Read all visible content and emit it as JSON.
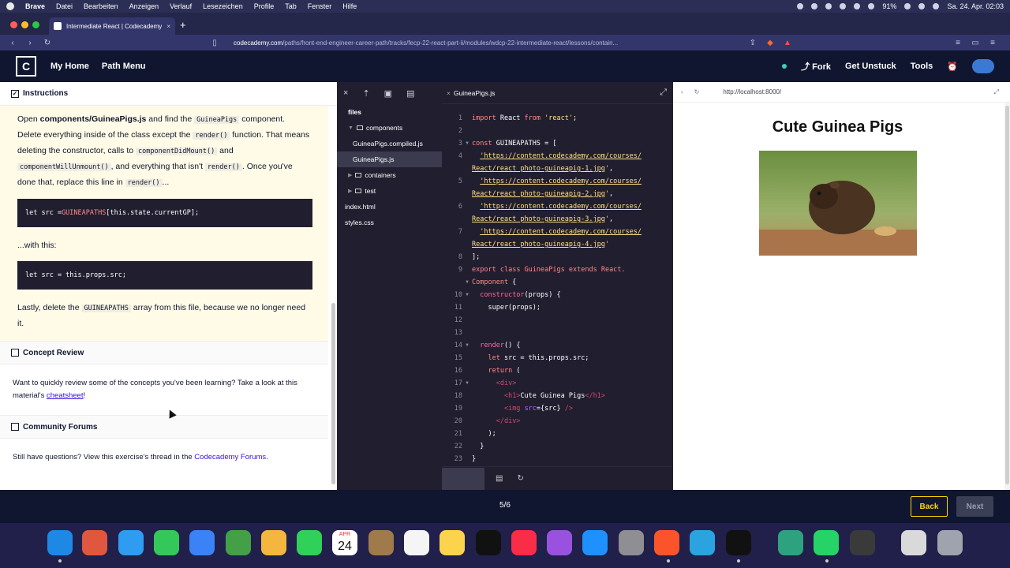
{
  "menubar": {
    "app": "Brave",
    "items": [
      "Datei",
      "Bearbeiten",
      "Anzeigen",
      "Verlauf",
      "Lesezeichen",
      "Profile",
      "Tab",
      "Fenster",
      "Hilfe"
    ],
    "battery": "91%",
    "clock": "Sa. 24. Apr. 02:03"
  },
  "browser": {
    "tab_title": "Intermediate React | Codecademy",
    "new_tab": "+",
    "url_domain": "codecademy.com",
    "url_path": "/paths/front-end-engineer-career-path/tracks/fecp-22-react-part-ii/modules/wdcp-22-intermediate-react/lessons/contain..."
  },
  "header": {
    "logo": "C",
    "nav": [
      "My Home",
      "Path Menu"
    ],
    "right": [
      "Fork",
      "Get Unstuck",
      "Tools"
    ]
  },
  "instructions": {
    "heading": "Instructions",
    "p1_a": "Open ",
    "p1_file": "components/GuineaPigs.js",
    "p1_b": " and find the ",
    "p1_comp": "GuineaPigs",
    "p1_c": " component. Delete everything inside of the class except the ",
    "p1_render": "render()",
    "p1_d": " function. That means deleting the constructor, calls to ",
    "p1_cdm": "componentDidMount()",
    "p1_e": " and ",
    "p1_cwu": "componentWillUnmount()",
    "p1_f": ", and everything that isn't ",
    "p1_render2": "render()",
    "p1_g": ". Once you've done that, replace this line in ",
    "p1_render3": "render()",
    "p1_h": "...",
    "code1_a": "let src = ",
    "code1_b": "GUINEAPATHS",
    "code1_c": "[this.state.currentGP];",
    "with_this": "...with this:",
    "code2": "let src = this.props.src;",
    "p2_a": "Lastly, delete the ",
    "p2_code": "GUINEAPATHS",
    "p2_b": " array from this file, because we no longer need it."
  },
  "concept_review": {
    "heading": "Concept Review",
    "text_a": "Want to quickly review some of the concepts you've been learning? Take a look at this material's ",
    "link": "cheatsheet",
    "text_b": "!"
  },
  "community": {
    "heading": "Community Forums",
    "text_a": "Still have questions? View this exercise's thread in the ",
    "link": "Codecademy Forums",
    "text_b": "."
  },
  "file_tree": {
    "root": "files",
    "items": [
      {
        "label": "components",
        "type": "folder",
        "open": true,
        "depth": 1
      },
      {
        "label": "GuineaPigs.compiled.js",
        "type": "file",
        "depth": 2
      },
      {
        "label": "GuineaPigs.js",
        "type": "file",
        "depth": 2,
        "selected": true
      },
      {
        "label": "containers",
        "type": "folder",
        "open": false,
        "depth": 1
      },
      {
        "label": "test",
        "type": "folder",
        "open": false,
        "depth": 1
      },
      {
        "label": "index.html",
        "type": "file",
        "depth": 0
      },
      {
        "label": "styles.css",
        "type": "file",
        "depth": 0
      }
    ]
  },
  "editor": {
    "tab": "GuineaPigs.js",
    "lines": [
      {
        "n": "1",
        "fold": "",
        "html": "<span class='kw'>import</span> React <span class='kw'>from</span> <span class='q'>'react'</span>;"
      },
      {
        "n": "2",
        "fold": "",
        "html": ""
      },
      {
        "n": "3",
        "fold": "▼",
        "html": "<span class='kw'>const</span> GUINEAPATHS = ["
      },
      {
        "n": "4",
        "fold": "",
        "html": "  <span class='str'>'https://content.codecademy.com/courses/</span>"
      },
      {
        "n": "",
        "fold": "",
        "html": "<span class='str'>React/react_photo-guineapig-1.jpg</span><span class='q'>'</span>,"
      },
      {
        "n": "5",
        "fold": "",
        "html": "  <span class='str'>'https://content.codecademy.com/courses/</span>"
      },
      {
        "n": "",
        "fold": "",
        "html": "<span class='str'>React/react_photo-guineapig-2.jpg</span><span class='q'>'</span>,"
      },
      {
        "n": "6",
        "fold": "",
        "html": "  <span class='str'>'https://content.codecademy.com/courses/</span>"
      },
      {
        "n": "",
        "fold": "",
        "html": "<span class='str'>React/react_photo-guineapig-3.jpg</span><span class='q'>'</span>,"
      },
      {
        "n": "7",
        "fold": "",
        "html": "  <span class='str'>'https://content.codecademy.com/courses/</span>"
      },
      {
        "n": "",
        "fold": "",
        "html": "<span class='str'>React/react_photo-guineapig-4.jpg</span><span class='q'>'</span>"
      },
      {
        "n": "8",
        "fold": "",
        "html": "];"
      },
      {
        "n": "9",
        "fold": "",
        "html": "<span class='kw'>export</span> <span class='kw'>class</span> <span class='cls'>GuineaPigs</span> <span class='kw'>extends</span> <span class='cls'>React.</span>"
      },
      {
        "n": "",
        "fold": "▼",
        "html": "<span class='cls'>Component</span> {"
      },
      {
        "n": "10",
        "fold": "▼",
        "html": "  <span class='fn'>constructor</span>(props) {"
      },
      {
        "n": "11",
        "fold": "",
        "html": "    super(props);"
      },
      {
        "n": "12",
        "fold": "",
        "html": ""
      },
      {
        "n": "13",
        "fold": "",
        "html": ""
      },
      {
        "n": "14",
        "fold": "▼",
        "html": "  <span class='fn'>render</span>() {"
      },
      {
        "n": "15",
        "fold": "",
        "html": "    <span class='kw'>let</span> src = this.props.src;"
      },
      {
        "n": "16",
        "fold": "",
        "html": "    <span class='kw'>return</span> ("
      },
      {
        "n": "17",
        "fold": "▼",
        "html": "      <span class='tag'>&lt;div&gt;</span>"
      },
      {
        "n": "18",
        "fold": "",
        "html": "        <span class='tag'>&lt;h1&gt;</span>Cute Guinea Pigs<span class='tag'>&lt;/h1&gt;</span>"
      },
      {
        "n": "19",
        "fold": "",
        "html": "        <span class='tag'>&lt;img</span> <span class='attr'>src</span>={src} <span class='tag'>/&gt;</span>"
      },
      {
        "n": "20",
        "fold": "",
        "html": "      <span class='tag'>&lt;/div&gt;</span>"
      },
      {
        "n": "21",
        "fold": "",
        "html": "    );"
      },
      {
        "n": "22",
        "fold": "",
        "html": "  }"
      },
      {
        "n": "23",
        "fold": "",
        "html": "}"
      }
    ]
  },
  "preview": {
    "url": "http://localhost:8000/",
    "heading": "Cute Guinea Pigs"
  },
  "footer": {
    "progress": "5/6",
    "back": "Back",
    "next": "Next"
  },
  "dock": {
    "calendar_month": "APR",
    "calendar_day": "24"
  },
  "colors": {
    "brand_navy": "#10162f",
    "accent_yellow": "#ffd300",
    "instructions_bg": "#fffbe6",
    "editor_bg": "#211e2f",
    "link": "#3a10e5"
  }
}
